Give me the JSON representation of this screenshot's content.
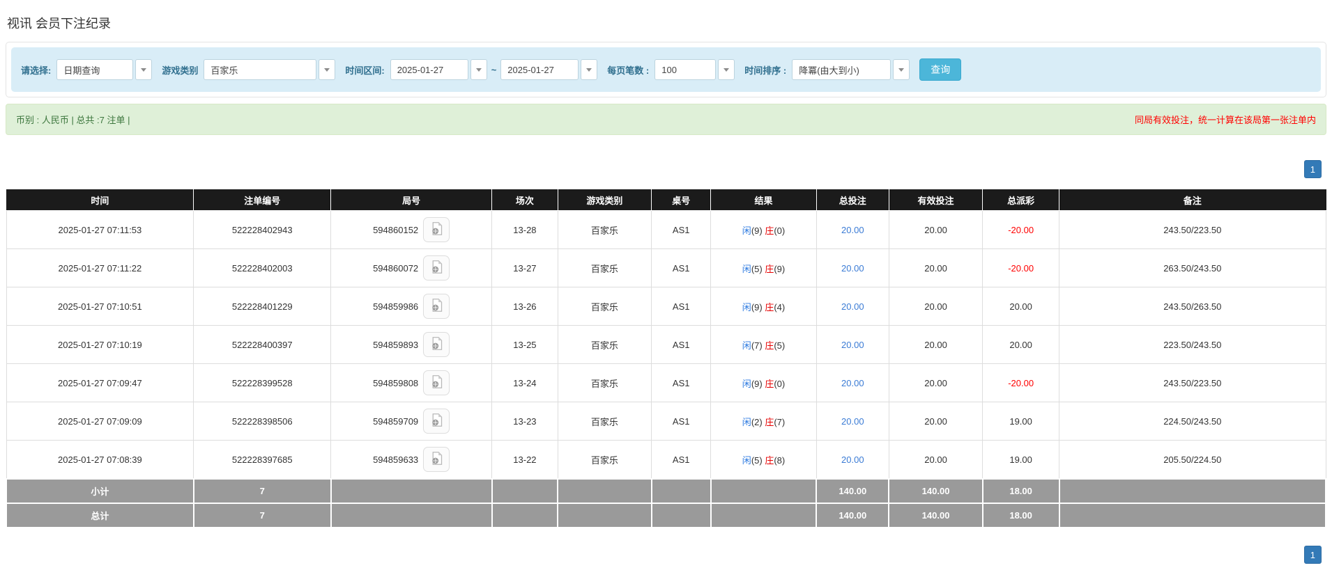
{
  "page": {
    "title": "视讯 会员下注纪录"
  },
  "filters": {
    "select_label": "请选择:",
    "select_value": "日期查询",
    "game_label": "游戏类别",
    "game_value": "百家乐",
    "range_label": "时间区间:",
    "date_from": "2025-01-27",
    "tilde": "~",
    "date_to": "2025-01-27",
    "per_page_label": "每页笔数 :",
    "per_page_value": "100",
    "sort_label": "时间排序 :",
    "sort_value": "降冪(由大到小)",
    "search_button": "查询"
  },
  "summary_bar": {
    "left_text": "币别 : 人民币 | 总共 :7 注单 |",
    "right_notice": "同局有效投注，统一计算在该局第一张注单内"
  },
  "pagination": {
    "page": "1"
  },
  "table": {
    "headers": [
      "时间",
      "注单编号",
      "局号",
      "场次",
      "游戏类别",
      "桌号",
      "结果",
      "总投注",
      "有效投注",
      "总派彩",
      "备注"
    ],
    "result_labels": {
      "player": "闲",
      "banker": "庄"
    },
    "icons": {
      "round_icon": "video-replay-file-icon"
    },
    "rows": [
      {
        "time": "2025-01-27 07:11:53",
        "bet_id": "522228402943",
        "round_id": "594860152",
        "session": "13-28",
        "game": "百家乐",
        "table_no": "AS1",
        "player_score": "9",
        "banker_score": "0",
        "total_bet": "20.00",
        "valid_bet": "20.00",
        "payout": "-20.00",
        "remark": "243.50/223.50"
      },
      {
        "time": "2025-01-27 07:11:22",
        "bet_id": "522228402003",
        "round_id": "594860072",
        "session": "13-27",
        "game": "百家乐",
        "table_no": "AS1",
        "player_score": "5",
        "banker_score": "9",
        "total_bet": "20.00",
        "valid_bet": "20.00",
        "payout": "-20.00",
        "remark": "263.50/243.50"
      },
      {
        "time": "2025-01-27 07:10:51",
        "bet_id": "522228401229",
        "round_id": "594859986",
        "session": "13-26",
        "game": "百家乐",
        "table_no": "AS1",
        "player_score": "9",
        "banker_score": "4",
        "total_bet": "20.00",
        "valid_bet": "20.00",
        "payout": "20.00",
        "remark": "243.50/263.50"
      },
      {
        "time": "2025-01-27 07:10:19",
        "bet_id": "522228400397",
        "round_id": "594859893",
        "session": "13-25",
        "game": "百家乐",
        "table_no": "AS1",
        "player_score": "7",
        "banker_score": "5",
        "total_bet": "20.00",
        "valid_bet": "20.00",
        "payout": "20.00",
        "remark": "223.50/243.50"
      },
      {
        "time": "2025-01-27 07:09:47",
        "bet_id": "522228399528",
        "round_id": "594859808",
        "session": "13-24",
        "game": "百家乐",
        "table_no": "AS1",
        "player_score": "9",
        "banker_score": "0",
        "total_bet": "20.00",
        "valid_bet": "20.00",
        "payout": "-20.00",
        "remark": "243.50/223.50"
      },
      {
        "time": "2025-01-27 07:09:09",
        "bet_id": "522228398506",
        "round_id": "594859709",
        "session": "13-23",
        "game": "百家乐",
        "table_no": "AS1",
        "player_score": "2",
        "banker_score": "7",
        "total_bet": "20.00",
        "valid_bet": "20.00",
        "payout": "19.00",
        "remark": "224.50/243.50"
      },
      {
        "time": "2025-01-27 07:08:39",
        "bet_id": "522228397685",
        "round_id": "594859633",
        "session": "13-22",
        "game": "百家乐",
        "table_no": "AS1",
        "player_score": "5",
        "banker_score": "8",
        "total_bet": "20.00",
        "valid_bet": "20.00",
        "payout": "19.00",
        "remark": "205.50/224.50"
      }
    ],
    "subtotal": {
      "label": "小计",
      "count": "7",
      "total_bet": "140.00",
      "valid_bet": "140.00",
      "payout": "18.00"
    },
    "total": {
      "label": "总计",
      "count": "7",
      "total_bet": "140.00",
      "valid_bet": "140.00",
      "payout": "18.00"
    }
  },
  "colors": {
    "header_bg": "#1b1b1b",
    "summary_row_bg": "#9a9a9a",
    "filter_bar_bg": "#d9edf7",
    "filter_label": "#31708f",
    "green_bar_bg": "#dff0d8",
    "green_text": "#3c763d",
    "notice_red": "#ff0000",
    "search_button_bg": "#4cb6d9",
    "pager_blue": "#337ab7",
    "player_blue": "#2d7ae0",
    "banker_red": "#e60000",
    "amount_link_blue": "#3a7bd5"
  }
}
